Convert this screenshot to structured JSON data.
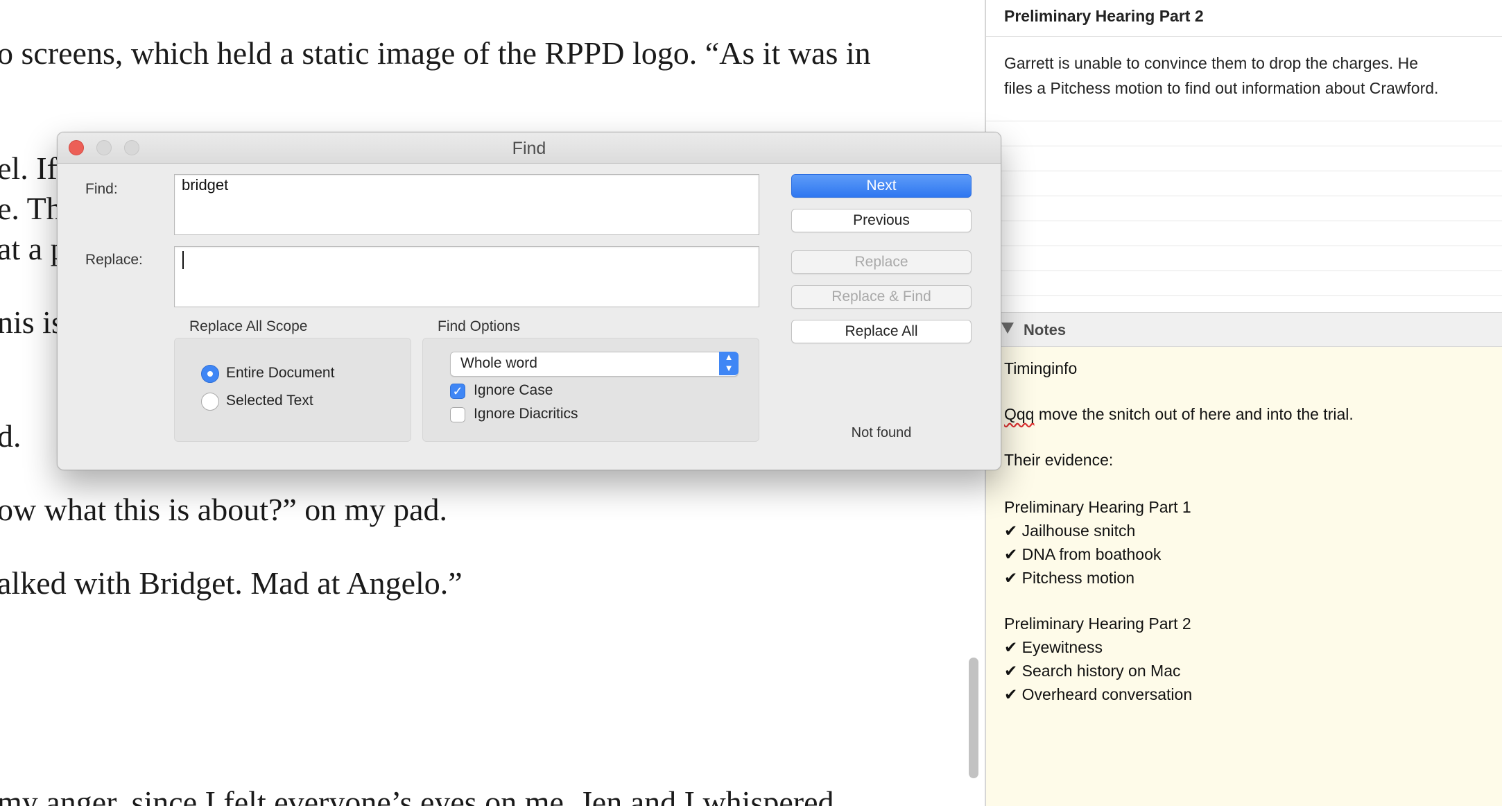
{
  "editor": {
    "lines": [
      "o screens, which held a static image of the RPPD logo. “As it was in",
      "el. If",
      "e. Th",
      "at a p",
      "nis is",
      "d.",
      "ow what this is about?” on my pad.",
      "alked with Bridget. Mad at Angelo.”",
      "my anger, since I felt everyone’s eyes on me. Jen and I whispered"
    ]
  },
  "inspector": {
    "synopsis_title": "Preliminary Hearing Part 2",
    "synopsis_lines": [
      "Garrett is unable to convince them to drop the charges. He",
      "files a Pitchess motion to find out information about Crawford."
    ],
    "notes_label": "Notes",
    "notes": {
      "line1": "Timinginfo",
      "line2_prefix": "Qqq",
      "line2_rest": " move the snitch out of here and into the trial.",
      "line3": "Their evidence:",
      "part1_title": "Preliminary Hearing Part 1",
      "part1_items": [
        "✔ Jailhouse snitch",
        "✔ DNA from boathook",
        "✔ Pitchess motion"
      ],
      "part2_title": "Preliminary Hearing Part 2",
      "part2_items": [
        "✔ Eyewitness",
        "✔ Search history on Mac",
        "✔ Overheard conversation"
      ]
    }
  },
  "find_dialog": {
    "title": "Find",
    "find_label": "Find:",
    "find_value": "bridget",
    "replace_label": "Replace:",
    "replace_value": "",
    "scope": {
      "title": "Replace All Scope",
      "options": [
        "Entire Document",
        "Selected Text"
      ],
      "selected": "Entire Document"
    },
    "options": {
      "title": "Find Options",
      "match_mode": "Whole word",
      "ignore_case_label": "Ignore Case",
      "ignore_case": true,
      "ignore_diacritics_label": "Ignore Diacritics",
      "ignore_diacritics": false
    },
    "buttons": {
      "next": "Next",
      "previous": "Previous",
      "replace": "Replace",
      "replace_find": "Replace & Find",
      "replace_all": "Replace All"
    },
    "status": "Not found"
  },
  "colors": {
    "accent": "#3f86f5",
    "close": "#ec5f57",
    "notes_background": "#fefbe9"
  },
  "icons": {
    "close": "close-icon",
    "minimize": "minimize-icon",
    "zoom": "zoom-icon",
    "notes_toggle": "disclosure-triangle-icon",
    "select": "chevron-updown-icon",
    "checkmark": "checkmark-icon"
  }
}
